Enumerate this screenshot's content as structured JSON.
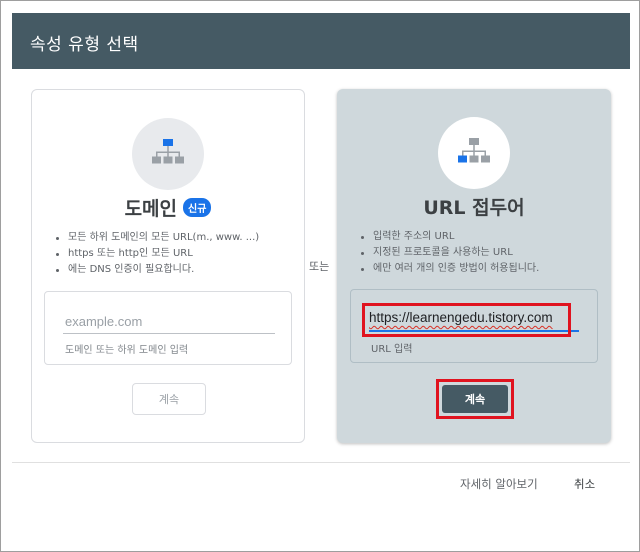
{
  "dialog": {
    "title": "속성 유형 선택"
  },
  "domain_card": {
    "title": "도메인",
    "badge": "신규",
    "bullets": [
      "모든 하위 도메인의 모든 URL(m., www. ...)",
      "https 또는 http인 모든 URL",
      "에는 DNS 인증이 필요합니다."
    ],
    "input_placeholder": "example.com",
    "input_help": "도메인 또는 하위 도메인 입력",
    "continue_label": "계속"
  },
  "or_label": "또는",
  "url_card": {
    "title": "URL 접두어",
    "bullets": [
      "입력한 주소의 URL",
      "지정된 프로토콜을 사용하는 URL",
      "에만 여러 개의 인증 방법이 허용됩니다."
    ],
    "input_value": "https://learnengedu.tistory.com",
    "input_help": "URL 입력",
    "continue_label": "계속"
  },
  "footer": {
    "learn_more": "자세히 알아보기",
    "cancel": "취소"
  },
  "colors": {
    "header_bg": "#455a64",
    "selected_card_bg": "#cfd8dc",
    "accent_blue": "#1a73e8",
    "highlight_red": "#e0131f"
  },
  "icons": {
    "domain": "sitemap-icon",
    "url_prefix": "sitemap-icon"
  }
}
